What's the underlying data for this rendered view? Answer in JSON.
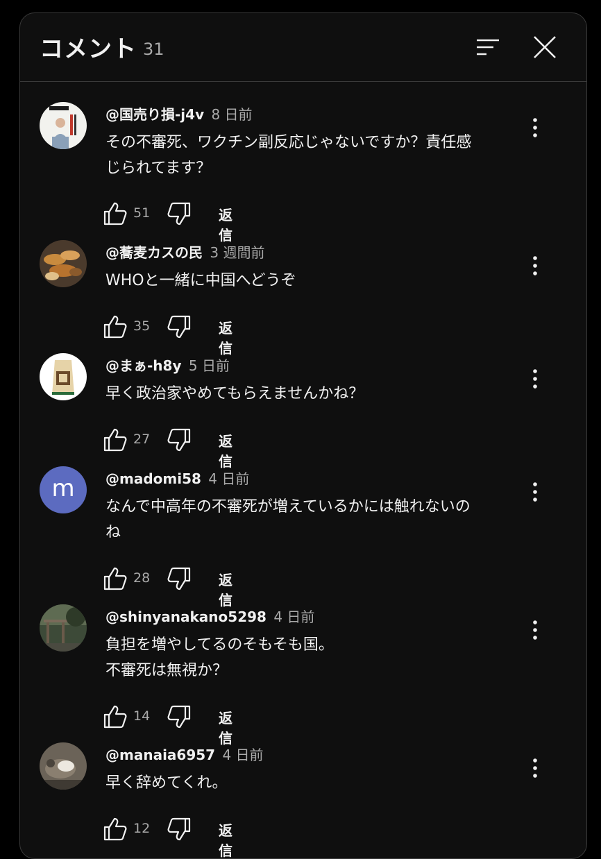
{
  "header": {
    "title": "コメント",
    "count": "31"
  },
  "reply_label": "返信",
  "colors": {
    "background": "#0f0f0f",
    "text": "#f1f1f1",
    "secondary_text": "#aaaaaa",
    "border": "#3a3a3a",
    "letter_avatar": "#5c6bc0"
  },
  "comments": [
    {
      "author": "@国売り損-j4v",
      "time": "8 日前",
      "lines": [
        "その不審死、ワクチン副反応じゃないですか？責任感",
        "じられてます？"
      ],
      "likes": "51",
      "avatar_icon": "book-cover-avatar"
    },
    {
      "author": "@蕎麦カスの民",
      "time": "3 週間前",
      "lines": [
        "WHOと一緒に中国へどうぞ"
      ],
      "likes": "35",
      "avatar_icon": "food-photo-avatar"
    },
    {
      "author": "@まぁ-h8y",
      "time": "5 日前",
      "lines": [
        "早く政治家やめてもらえませんかね？"
      ],
      "likes": "27",
      "avatar_icon": "rice-bag-avatar"
    },
    {
      "author": "@madomi58",
      "time": "4 日前",
      "lines": [
        "なんで中高年の不審死が増えているかには触れないの",
        "ね"
      ],
      "likes": "28",
      "avatar_letter": "m"
    },
    {
      "author": "@shinyanakano5298",
      "time": "4 日前",
      "lines": [
        "負担を増やしてるのそもそも国。",
        "不審死は無視か？"
      ],
      "likes": "14",
      "avatar_icon": "shrine-photo-avatar"
    },
    {
      "author": "@manaia6957",
      "time": "4 日前",
      "lines": [
        "早く辞めてくれ。"
      ],
      "likes": "12",
      "avatar_icon": "bird-photo-avatar"
    }
  ]
}
